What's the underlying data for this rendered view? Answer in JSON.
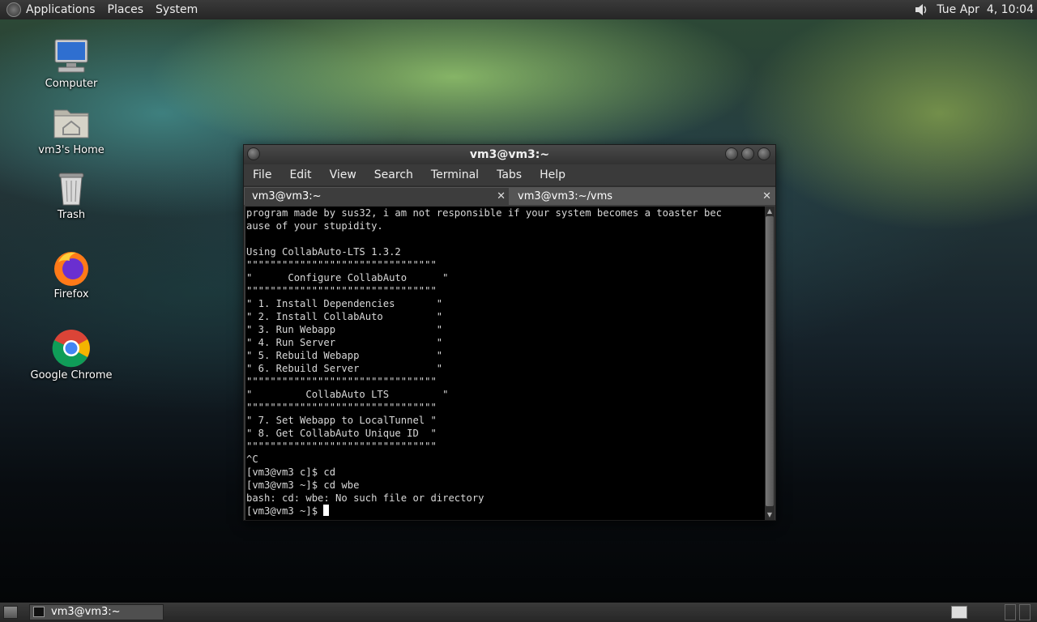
{
  "top_panel": {
    "menus": [
      "Applications",
      "Places",
      "System"
    ],
    "clock": "Tue Apr  4, 10:04"
  },
  "desktop": {
    "icons": [
      "Computer",
      "vm3's Home",
      "Trash",
      "Firefox",
      "Google Chrome"
    ]
  },
  "terminal": {
    "title": "vm3@vm3:~",
    "menu": [
      "File",
      "Edit",
      "View",
      "Search",
      "Terminal",
      "Tabs",
      "Help"
    ],
    "tabs": [
      {
        "label": "vm3@vm3:~",
        "close": "✕"
      },
      {
        "label": "vm3@vm3:~/vms",
        "close": "✕"
      }
    ],
    "output": "program made by sus32, i am not responsible if your system becomes a toaster bec\nause of your stupidity.\n\nUsing CollabAuto-LTS 1.3.2\n\"\"\"\"\"\"\"\"\"\"\"\"\"\"\"\"\"\"\"\"\"\"\"\"\"\"\"\"\"\"\"\"\n\"      Configure CollabAuto      \"\n\"\"\"\"\"\"\"\"\"\"\"\"\"\"\"\"\"\"\"\"\"\"\"\"\"\"\"\"\"\"\"\"\n\" 1. Install Dependencies       \"\n\" 2. Install CollabAuto         \"\n\" 3. Run Webapp                 \"\n\" 4. Run Server                 \"\n\" 5. Rebuild Webapp             \"\n\" 6. Rebuild Server             \"\n\"\"\"\"\"\"\"\"\"\"\"\"\"\"\"\"\"\"\"\"\"\"\"\"\"\"\"\"\"\"\"\"\n\"         CollabAuto LTS         \"\n\"\"\"\"\"\"\"\"\"\"\"\"\"\"\"\"\"\"\"\"\"\"\"\"\"\"\"\"\"\"\"\"\n\" 7. Set Webapp to LocalTunnel \"\n\" 8. Get CollabAuto Unique ID  \"\n\"\"\"\"\"\"\"\"\"\"\"\"\"\"\"\"\"\"\"\"\"\"\"\"\"\"\"\"\"\"\"\"\n^C\n[vm3@vm3 c]$ cd\n[vm3@vm3 ~]$ cd wbe\nbash: cd: wbe: No such file or directory\n",
    "prompt": "[vm3@vm3 ~]$ "
  },
  "taskbar": {
    "task_label": "vm3@vm3:~"
  }
}
